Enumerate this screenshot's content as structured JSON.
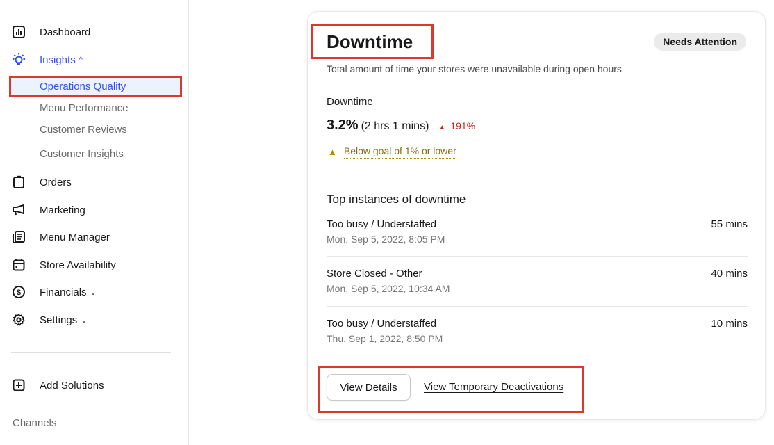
{
  "sidebar": {
    "items": [
      {
        "label": "Dashboard",
        "icon": "bar-chart-icon"
      },
      {
        "label": "Insights",
        "icon": "lightbulb-icon",
        "expanded": true
      },
      {
        "label": "Orders",
        "icon": "clipboard-icon"
      },
      {
        "label": "Marketing",
        "icon": "megaphone-icon"
      },
      {
        "label": "Menu Manager",
        "icon": "menu-document-icon"
      },
      {
        "label": "Store Availability",
        "icon": "calendar-icon"
      },
      {
        "label": "Financials",
        "icon": "dollar-icon"
      },
      {
        "label": "Settings",
        "icon": "gear-icon"
      },
      {
        "label": "Add Solutions",
        "icon": "plus-box-icon"
      }
    ],
    "insights_sub": [
      {
        "label": "Operations Quality",
        "active": true
      },
      {
        "label": "Menu Performance"
      },
      {
        "label": "Customer Reviews"
      },
      {
        "label": "Customer Insights"
      }
    ],
    "channels_label": "Channels",
    "accent_color": "#2f52f5"
  },
  "card": {
    "title": "Downtime",
    "badge": "Needs Attention",
    "subtitle": "Total amount of time your stores were unavailable during open hours",
    "metric_label": "Downtime",
    "metric_value": "3.2%",
    "metric_detail": "(2 hrs 1 mins)",
    "trend": "191%",
    "trend_color": "#c7281b",
    "goal_text": "Below goal of 1% or lower",
    "section_title": "Top instances of downtime",
    "instances": [
      {
        "reason": "Too busy / Understaffed",
        "time": "Mon, Sep 5, 2022, 8:05 PM",
        "duration": "55 mins"
      },
      {
        "reason": "Store Closed - Other",
        "time": "Mon, Sep 5, 2022, 10:34 AM",
        "duration": "40 mins"
      },
      {
        "reason": "Too busy / Understaffed",
        "time": "Thu, Sep 1, 2022, 8:50 PM",
        "duration": "10 mins"
      }
    ],
    "view_details_label": "View Details",
    "deactivations_label": "View Temporary Deactivations"
  }
}
